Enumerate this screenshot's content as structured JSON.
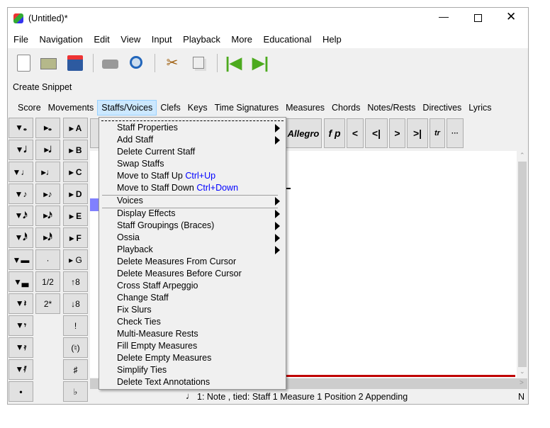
{
  "window": {
    "title": "(Untitled)*",
    "controls": [
      "minimize",
      "maximize",
      "close"
    ]
  },
  "menubar": [
    "File",
    "Navigation",
    "Edit",
    "View",
    "Input",
    "Playback",
    "More",
    "Educational",
    "Help"
  ],
  "toolbar": [
    "new-file-icon",
    "open-folder-icon",
    "save-icon",
    "print-icon",
    "print-preview-icon",
    "cut-icon",
    "copy-icon",
    "go-first-icon",
    "go-last-icon"
  ],
  "snippet_label": "Create Snippet",
  "tabs": [
    "Score",
    "Movements",
    "Staffs/Voices",
    "Clefs",
    "Keys",
    "Time Signatures",
    "Measures",
    "Chords",
    "Notes/Rests",
    "Directives",
    "Lyrics"
  ],
  "active_tab": "Staffs/Voices",
  "palette": {
    "col1": [
      "▼𝅝",
      "▼𝅗𝅥",
      "▼♩",
      "▼♪",
      "▼𝅘𝅥𝅯",
      "▼𝅘𝅥𝅰",
      "▼▬",
      "▼▃",
      "▼𝄽",
      "▼𝄾",
      "▼𝄿",
      "▼𝅀",
      "•"
    ],
    "col2": [
      "▸𝅝",
      "▸𝅗𝅥",
      "▸♩",
      "▸♪",
      "▸𝅘𝅥𝅯",
      "▸𝅘𝅥𝅰",
      "·",
      "1/2",
      "2*"
    ],
    "col3": [
      "▸ A",
      "▸ B",
      "▸ C",
      "▸ D",
      "▸ E",
      "▸ F",
      "▸ G",
      "↑8",
      "↓8",
      "!",
      "(♮)",
      "♯",
      "♭"
    ]
  },
  "score_toolbar": [
    "Allegro",
    "f p",
    "<",
    "<|",
    ">",
    ">|",
    "tr",
    "···"
  ],
  "menu": {
    "items": [
      {
        "label": "Staff Properties",
        "submenu": true
      },
      {
        "label": "Add Staff",
        "submenu": true
      },
      {
        "label": "Delete Current Staff"
      },
      {
        "label": "Swap Staffs"
      },
      {
        "label": "Move to Staff Up",
        "shortcut": "Ctrl+Up"
      },
      {
        "label": "Move to Staff Down",
        "shortcut": "Ctrl+Down"
      },
      {
        "label": "Voices",
        "submenu": true
      },
      {
        "label": "Display Effects",
        "submenu": true
      },
      {
        "label": "Staff Groupings (Braces)",
        "submenu": true
      },
      {
        "label": "Ossia",
        "submenu": true
      },
      {
        "label": "Playback",
        "submenu": true
      },
      {
        "label": "Delete Measures From Cursor"
      },
      {
        "label": "Delete Measures Before Cursor"
      },
      {
        "label": "Cross Staff Arpeggio"
      },
      {
        "label": "Change Staff"
      },
      {
        "label": "Fix Slurs"
      },
      {
        "label": "Check Ties"
      },
      {
        "label": "Multi-Measure Rests"
      },
      {
        "label": "Fill Empty Measures"
      },
      {
        "label": "Delete Empty Measures"
      },
      {
        "label": "Simplify Ties"
      },
      {
        "label": "Delete Text Annotations"
      }
    ]
  },
  "status": {
    "text": "1: Note , tied:  Staff 1 Measure 1 Position 2 Appending",
    "right": "N"
  },
  "colors": {
    "accent_tab": "#cce8ff",
    "shortcut": "#0000ff",
    "cursor_line": "#c00000",
    "selection": "#8080ff"
  }
}
